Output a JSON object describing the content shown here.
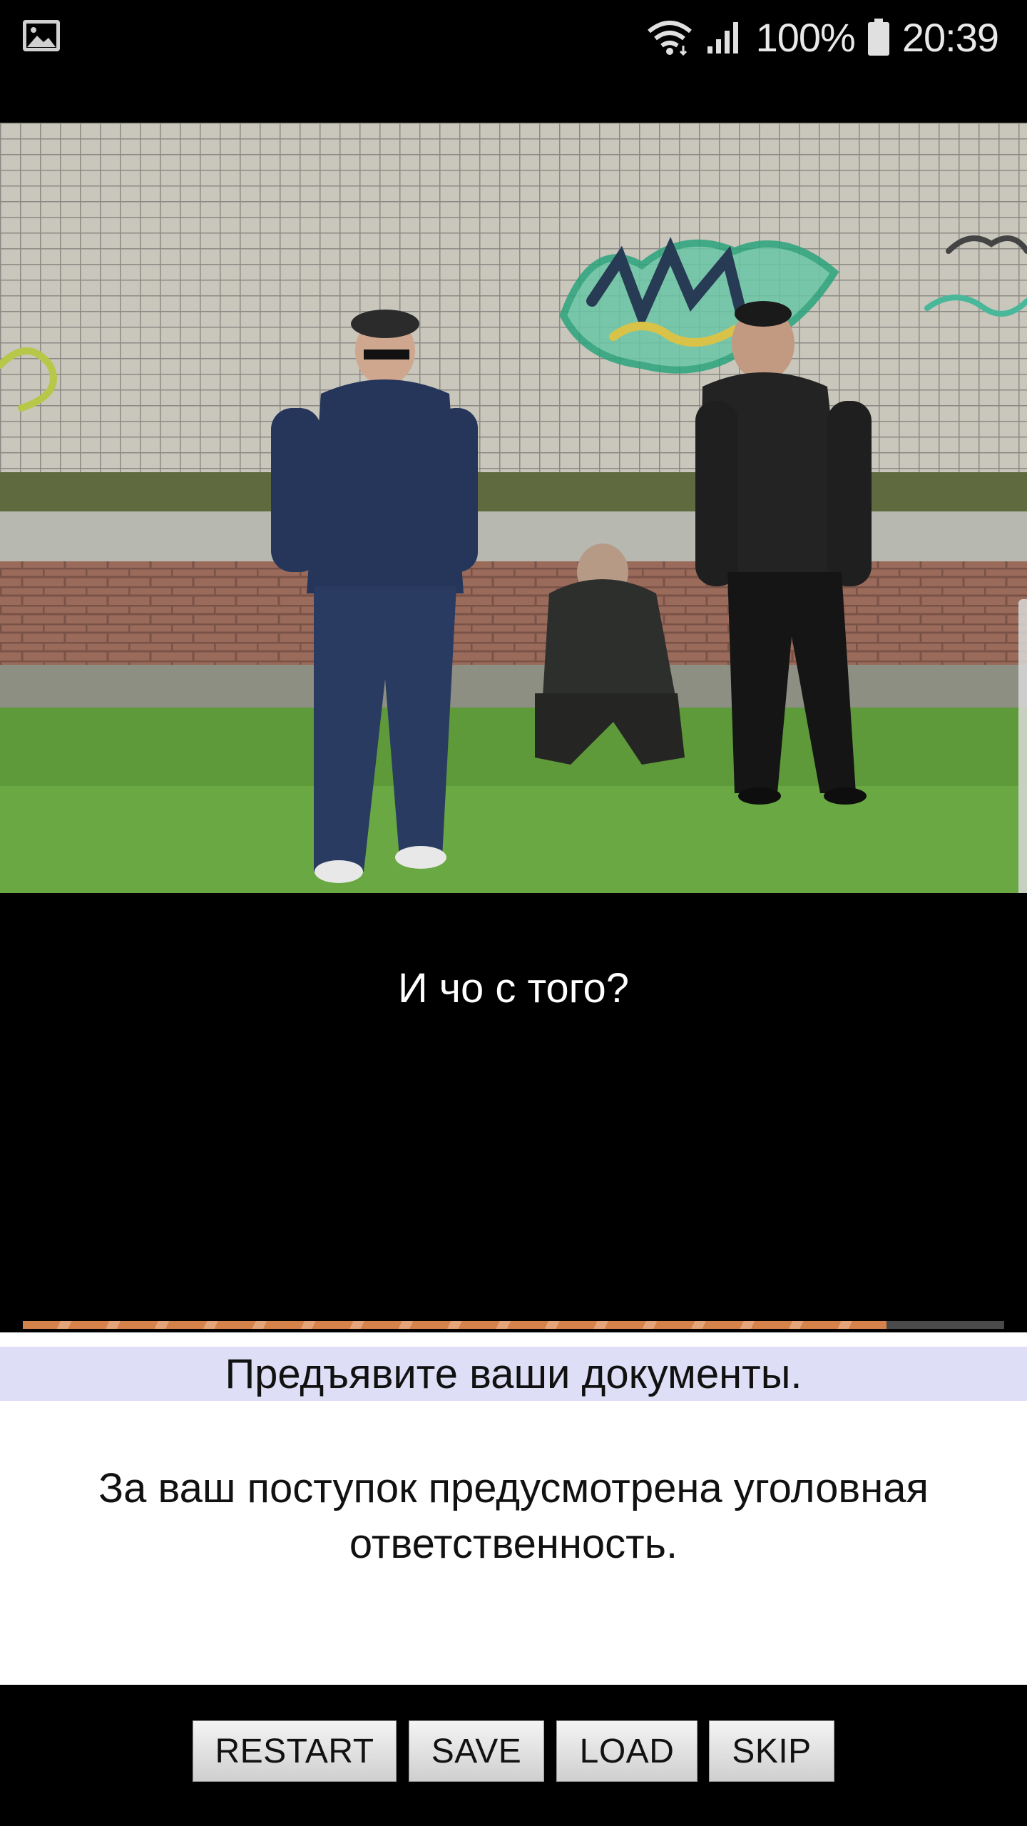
{
  "status_bar": {
    "battery_percent": "100%",
    "time": "20:39",
    "icons": [
      "gallery-icon",
      "wifi-icon",
      "signal-icon",
      "battery-icon"
    ]
  },
  "scene": {
    "description_icon": "video-frame"
  },
  "subtitle": "И чо с того?",
  "progress": {
    "fraction": 0.88,
    "fill_color": "#d6824b"
  },
  "choices": [
    "Предъявите ваши документы.",
    "За ваш поступок предусмотрена уголовная ответственность."
  ],
  "buttons": {
    "restart": "RESTART",
    "save": "SAVE",
    "load": "LOAD",
    "skip": "SKIP"
  }
}
